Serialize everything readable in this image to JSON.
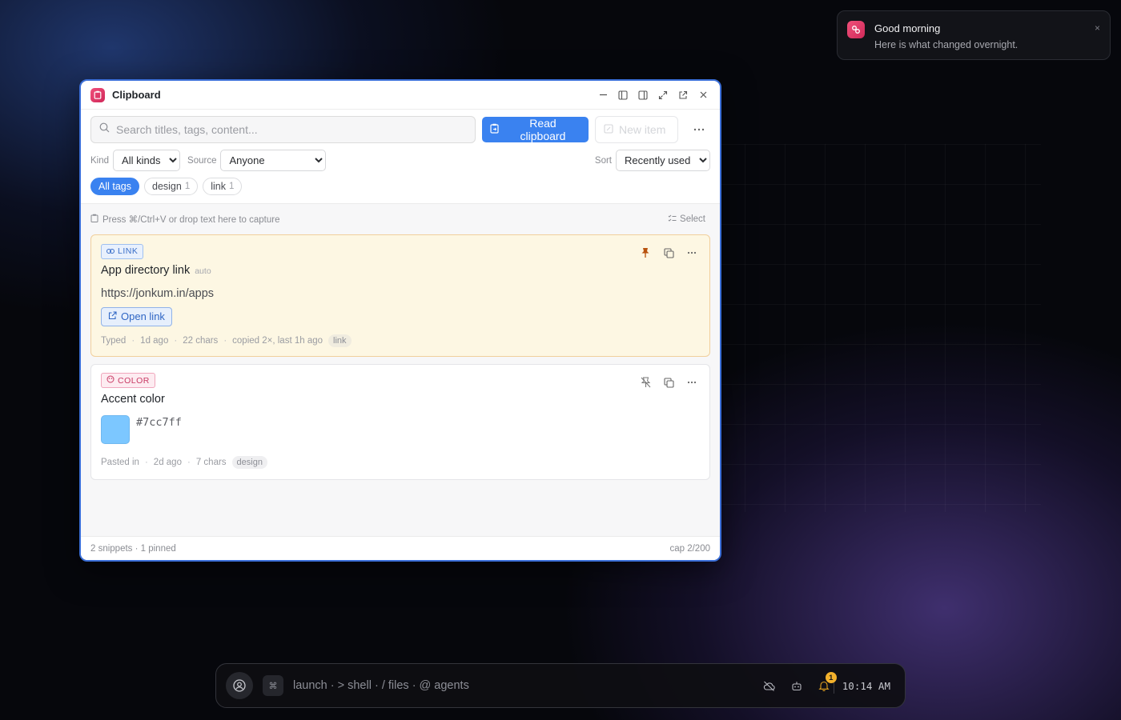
{
  "toast": {
    "title": "Good morning",
    "body": "Here is what changed overnight.",
    "close": "×"
  },
  "window": {
    "title": "Clipboard",
    "search_placeholder": "Search titles, tags, content...",
    "read_button": "Read clipboard",
    "new_button": "New item",
    "filters": {
      "kind_label": "Kind",
      "kind_value": "All kinds",
      "source_label": "Source",
      "source_value": "Anyone",
      "sort_label": "Sort",
      "sort_value": "Recently used"
    },
    "tags": [
      {
        "label": "All tags",
        "count": ""
      },
      {
        "label": "design",
        "count": "1"
      },
      {
        "label": "link",
        "count": "1"
      }
    ],
    "hint": "Press ⌘/Ctrl+V or drop text here to capture",
    "select_label": "Select",
    "cards": [
      {
        "kind": "LINK",
        "title": "App directory link",
        "auto": "auto",
        "url": "https://jonkum.in/apps",
        "open_label": "Open link",
        "meta": {
          "source": "Typed",
          "age": "1d ago",
          "chars": "22 chars",
          "copied": "copied 2×, last 1h ago",
          "tag": "link"
        }
      },
      {
        "kind": "COLOR",
        "title": "Accent color",
        "hex": "#7cc7ff",
        "swatch_color": "#7cc7ff",
        "meta": {
          "source": "Pasted in",
          "age": "2d ago",
          "chars": "7 chars",
          "tag": "design"
        }
      }
    ],
    "status_left": "2 snippets · 1 pinned",
    "status_right": "cap 2/200"
  },
  "dock": {
    "input": "launch · > shell · / files · @ agents",
    "cmd_glyph": "⌘",
    "notif_count": "1",
    "clock": "10:14 AM"
  },
  "colors": {
    "accent": "#3a82f0",
    "pinned_bg": "#fdf7e3",
    "brand": "#e0406c"
  }
}
